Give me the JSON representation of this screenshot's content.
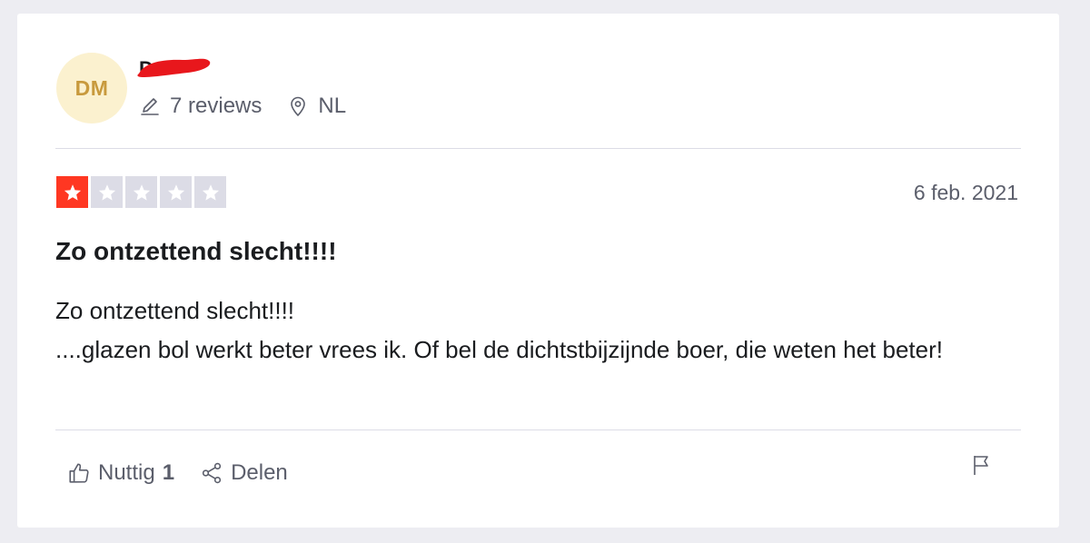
{
  "reviewer": {
    "initials": "DM",
    "name": "D",
    "reviews_label": "7 reviews",
    "country": "NL"
  },
  "review": {
    "rating": 1,
    "max_rating": 5,
    "date": "6 feb. 2021",
    "title": "Zo ontzettend slecht!!!!",
    "body_line1": "Zo ontzettend slecht!!!!",
    "body_line2": "....glazen bol werkt beter vrees ik. Of bel de dichtstbijzijnde boer, die weten het beter!"
  },
  "actions": {
    "useful_label": "Nuttig",
    "useful_count": "1",
    "share_label": "Delen"
  },
  "icons": {
    "reviews": "pencil-icon",
    "location": "location-pin-icon",
    "useful": "thumbs-up-icon",
    "share": "share-icon",
    "report": "flag-icon"
  },
  "colors": {
    "star_filled": "#ff3722",
    "star_empty": "#dcdce6",
    "avatar_bg": "#fbf1cf",
    "avatar_text": "#c89a3d",
    "redaction": "#e8171c"
  }
}
